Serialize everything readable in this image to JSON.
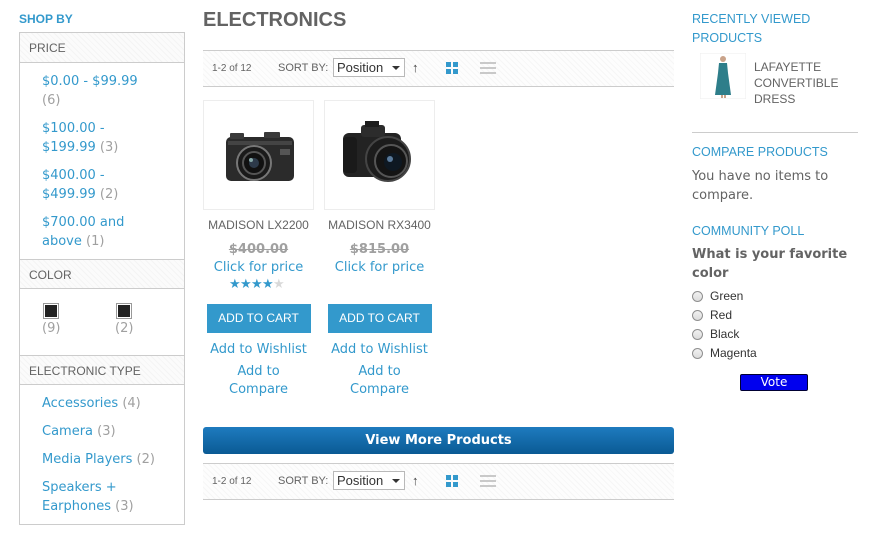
{
  "sidebar": {
    "shop_by": "SHOP BY",
    "price": {
      "title": "PRICE",
      "items": [
        {
          "line1": "$0.00 - $99.99",
          "line2": "",
          "count": "(6)"
        },
        {
          "line1": "$100.00 -",
          "line2": "$199.99",
          "count": "(3)"
        },
        {
          "line1": "$400.00 -",
          "line2": "$499.99",
          "count": "(2)"
        },
        {
          "line1": "$700.00 and",
          "line2": "above",
          "count": "(1)"
        }
      ]
    },
    "color": {
      "title": "COLOR",
      "swatches": [
        {
          "color": "#222222",
          "count": "(9)"
        },
        {
          "color": "#222222",
          "count": "(2)"
        }
      ]
    },
    "electronic_type": {
      "title": "ELECTRONIC TYPE",
      "items": [
        {
          "line1": "Accessories",
          "line2": "",
          "count": "(4)"
        },
        {
          "line1": "Camera",
          "line2": "",
          "count": "(3)"
        },
        {
          "line1": "Media Players",
          "line2": "",
          "count": "(2)"
        },
        {
          "line1": "Speakers +",
          "line2": "Earphones",
          "count": "(3)"
        }
      ]
    }
  },
  "main": {
    "title": "ELECTRONICS",
    "toolbar": {
      "count": "1-2 of 12",
      "sort_label": "SORT BY:",
      "sort_value": "Position"
    },
    "products": [
      {
        "name": "MADISON LX2200",
        "old_price": "$400.00",
        "click": "Click for price",
        "rating": 4,
        "add_to_cart": "ADD TO CART",
        "wishlist": "Add to Wishlist",
        "compare1": "Add to",
        "compare2": "Compare"
      },
      {
        "name": "MADISON RX3400",
        "old_price": "$815.00",
        "click": "Click for price",
        "rating": 0,
        "add_to_cart": "ADD TO CART",
        "wishlist": "Add to Wishlist",
        "compare1": "Add to",
        "compare2": "Compare"
      }
    ],
    "view_more": "View More Products"
  },
  "right": {
    "recently_viewed": {
      "title1": "RECENTLY VIEWED",
      "title2": "PRODUCTS",
      "item_line1": "LAFAYETTE",
      "item_line2": "CONVERTIBLE",
      "item_line3": "DRESS"
    },
    "compare": {
      "title": "COMPARE PRODUCTS",
      "text1": "You have no items to",
      "text2": "compare."
    },
    "poll": {
      "title": "COMMUNITY POLL",
      "question1": "What is your favorite",
      "question2": "color",
      "options": [
        "Green",
        "Red",
        "Black",
        "Magenta"
      ],
      "vote": "Vote"
    }
  },
  "colors": {
    "accent": "#3399cc",
    "vote": "#0000ee",
    "view_more": "#1e7bbf"
  }
}
